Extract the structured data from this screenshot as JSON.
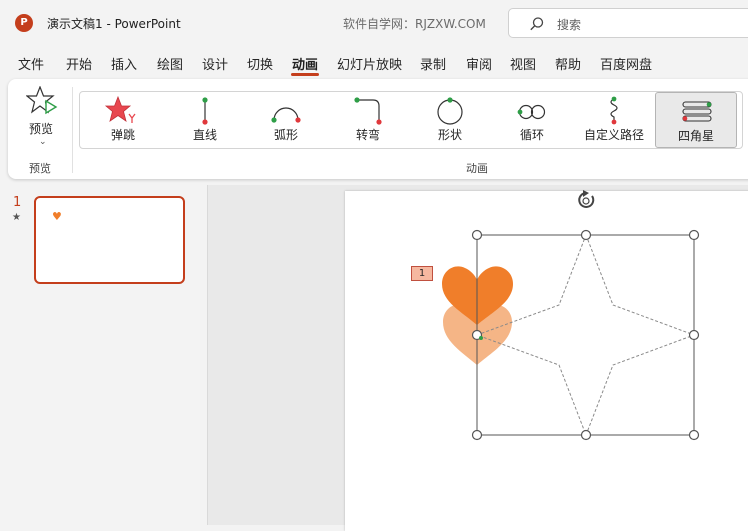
{
  "titlebar": {
    "app_icon_letter": "P",
    "document_title": "演示文稿1  -  PowerPoint",
    "site_text": "软件自学网：RJZXW.COM",
    "search_placeholder": "搜索"
  },
  "menu": {
    "items": [
      "文件",
      "开始",
      "插入",
      "绘图",
      "设计",
      "切换",
      "动画",
      "幻灯片放映",
      "录制",
      "审阅",
      "视图",
      "帮助",
      "百度网盘"
    ],
    "active": "动画"
  },
  "ribbon": {
    "preview_label": "预览",
    "preview_group_label": "预览",
    "animation_group_label": "动画",
    "animations": [
      {
        "label": "弹跳",
        "icon": "bounce-star-icon",
        "selected": false
      },
      {
        "label": "直线",
        "icon": "line-path-icon",
        "selected": false
      },
      {
        "label": "弧形",
        "icon": "arc-path-icon",
        "selected": false
      },
      {
        "label": "转弯",
        "icon": "turn-path-icon",
        "selected": false
      },
      {
        "label": "形状",
        "icon": "shape-path-icon",
        "selected": false
      },
      {
        "label": "循环",
        "icon": "loop-path-icon",
        "selected": false
      },
      {
        "label": "自定义路径",
        "icon": "custom-path-icon",
        "selected": false
      },
      {
        "label": "四角星",
        "icon": "four-point-star-icon",
        "selected": true
      }
    ]
  },
  "slides_pane": {
    "slide_number": "1",
    "slide_marker": "★"
  },
  "slide": {
    "animation_tag": "1",
    "colors": {
      "heart": "#f07e2a",
      "heart_ghost": "#f5b586",
      "accent": "#c43e1c"
    }
  }
}
